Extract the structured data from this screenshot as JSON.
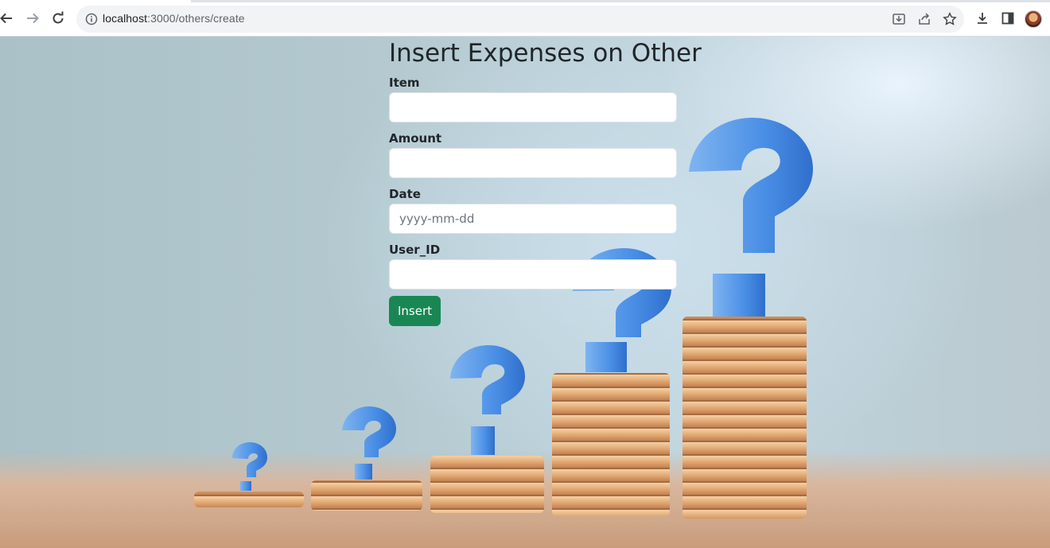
{
  "browser": {
    "url_host": "localhost",
    "url_path": ":3000/others/create",
    "icons": {
      "back": "arrow-left-icon",
      "forward": "arrow-right-icon",
      "reload": "reload-icon",
      "site_info": "info-icon",
      "install": "install-app-icon",
      "share": "share-icon",
      "bookmark": "star-icon",
      "downloads": "download-icon",
      "side_panel": "side-panel-icon",
      "profile": "avatar"
    }
  },
  "form": {
    "title": "Insert Expenses on Other",
    "fields": [
      {
        "label": "Item",
        "value": "",
        "placeholder": ""
      },
      {
        "label": "Amount",
        "value": "",
        "placeholder": ""
      },
      {
        "label": "Date",
        "value": "",
        "placeholder": "yyyy-mm-dd"
      },
      {
        "label": "User_ID",
        "value": "",
        "placeholder": ""
      }
    ],
    "submit_label": "Insert"
  },
  "colors": {
    "button": "#198754",
    "text": "#212529"
  }
}
